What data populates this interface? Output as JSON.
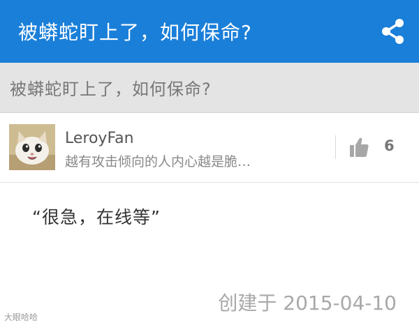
{
  "header": {
    "title": "被蟒蛇盯上了，如何保命?",
    "share_icon": "share-icon"
  },
  "question": {
    "title": "被蟒蛇盯上了，如何保命?"
  },
  "answer": {
    "author": "LeroyFan",
    "excerpt": "越有攻击倾向的人内心越是脆…",
    "votes": "6",
    "vote_icon": "thumbs-up-icon",
    "body": "“很急，在线等”",
    "created": "创建于 2015-04-10"
  },
  "watermark": "大眼哈哈",
  "colors": {
    "topbar": "#1a7fd9",
    "question_bar": "#e4e4e4"
  }
}
